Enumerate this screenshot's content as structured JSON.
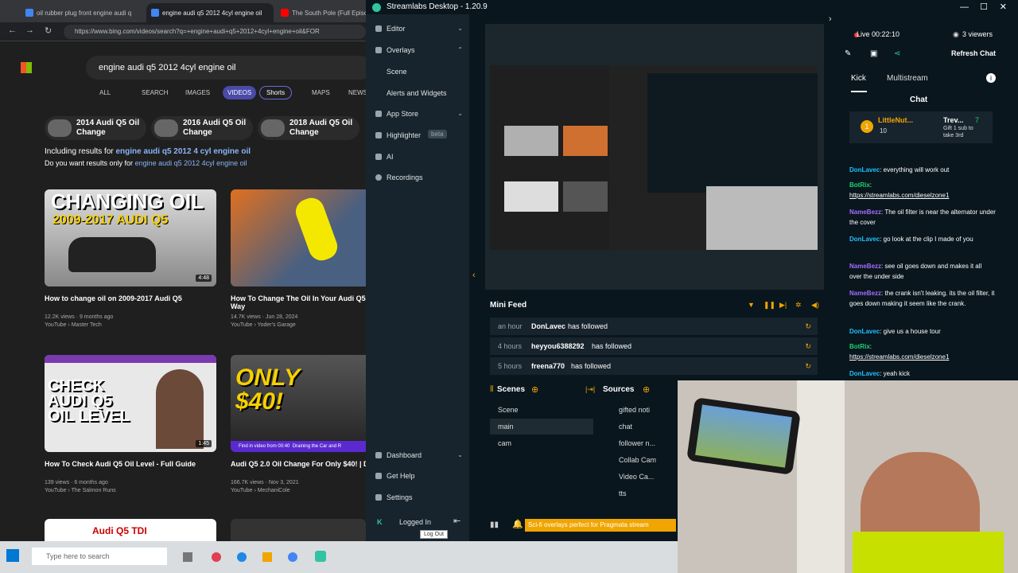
{
  "browser": {
    "tabs": [
      {
        "label": "oil rubber plug front engine audi q"
      },
      {
        "label": "engine audi q5 2012 4cyl engine oil"
      },
      {
        "label": "The South Pole (Full Episode)"
      }
    ],
    "url": "https://www.bing.com/videos/search?q=+engine+audi+q5+2012+4cyl+engine+oil&FOR",
    "search_value": "engine audi q5 2012 4cyl engine oil",
    "nav": [
      "ALL",
      "SEARCH",
      "IMAGES",
      "VIDEOS",
      "Shorts",
      "MAPS",
      "NEWS"
    ],
    "chips": [
      {
        "line1": "2014 Audi Q5 Oil",
        "line2": "Change"
      },
      {
        "line1": "2016 Audi Q5 Oil",
        "line2": "Change"
      },
      {
        "line1": "2018 Audi Q5 Oil",
        "line2": "Change"
      }
    ],
    "including_prefix": "Including results for ",
    "including_query": "engine audi q5 2012 4 cyl engine oil",
    "dym_prefix": "Do you want results only for ",
    "dym_query": "engine audi q5 2012 4cyl engine oil",
    "videos": [
      {
        "overlay": "CHANGING OIL",
        "overlay2": "2009-2017 AUDI Q5",
        "duration": "4:48",
        "title": "How to change oil on 2009-2017 Audi Q5",
        "meta1": "12.2K views · 9 months ago",
        "meta2": "YouTube › Master Tech"
      },
      {
        "overlay": "",
        "overlay2": "",
        "duration": "",
        "title": "How To Change The Oil In Your Audi Q5 T",
        "title2": "Way",
        "meta1": "14.7K views · Jun 28, 2024",
        "meta2": "YouTube › Yoder's Garage"
      },
      {
        "overlay": "CHECK",
        "overlay2": "AUDI Q5",
        "overlay3": "OIL LEVEL",
        "duration": "1:45",
        "title": "How To Check Audi Q5 Oil Level - Full Guide",
        "meta1": "139 views · 6 months ago",
        "meta2": "YouTube › The Salmon Runs"
      },
      {
        "overlay": "ONLY",
        "overlay2": "$40!",
        "find": "Find in video from 00:40",
        "find2": "Draining the Car and R",
        "duration": "",
        "title": "Audi Q5 2.0 Oil Change For Only $40! | D",
        "meta1": "166.7K views · Nov 3, 2021",
        "meta2": "YouTube › MechaniCole"
      },
      {
        "overlay": "Audi Q5 TDI"
      }
    ]
  },
  "streamlabs": {
    "title": "Streamlabs Desktop - 1.20.9",
    "sidebar": [
      "Editor",
      "Overlays",
      "Scene",
      "Alerts and Widgets",
      "App Store",
      "Highlighter",
      "AI",
      "Recordings"
    ],
    "beta": "beta",
    "sidebar_bottom": [
      "Dashboard",
      "Get Help",
      "Settings",
      "Logged In"
    ],
    "logout_tip": "Log Out",
    "minifeed_title": "Mini Feed",
    "feed": [
      {
        "time": "an hour",
        "name": "DonLavec",
        "action": "has followed"
      },
      {
        "time": "4 hours",
        "name": "heyyou6388292",
        "action": "has followed"
      },
      {
        "time": "5 hours",
        "name": "freena770",
        "action": "has followed"
      }
    ],
    "scenes_title": "Scenes",
    "sources_title": "Sources",
    "scenes": [
      "Scene",
      "main",
      "cam"
    ],
    "sources": [
      "gifted noti",
      "chat",
      "follower n...",
      "Collab Cam",
      "Video Ca...",
      "tts"
    ],
    "promo": "Sci-fi overlays perfect for Pragmata stream",
    "live": "Live 00:22:10",
    "viewers": "3 viewers",
    "refresh": "Refresh Chat",
    "chat_tabs": [
      "Kick",
      "Multistream"
    ],
    "chat_title": "Chat",
    "pinned": {
      "user": "LittleNut...",
      "count": "10",
      "user2": "Trev...",
      "n": "7",
      "gift": "Gift 1 sub to",
      "gift2": "take 3rd"
    },
    "messages": [
      {
        "u": "DonLavec",
        "c": "u1",
        "t": ": everything will work out"
      },
      {
        "u": "BotRix",
        "c": "u3",
        "t": ":",
        "link": "https://streamlabs.com/dieselzone1"
      },
      {
        "u": "NameBezz",
        "c": "u2",
        "t": ": The oil filter is near the alternator under the cover"
      },
      {
        "u": "DonLavec",
        "c": "u1",
        "t": ": go look at the clip I made of you"
      },
      {
        "u": "NameBezz",
        "c": "u2",
        "t": ": see oil goes down and makes it all over the under side"
      },
      {
        "u": "NameBezz",
        "c": "u2",
        "t": ": the crank isn't leaking. its the oil filter, it goes down making it seem like the crank."
      },
      {
        "u": "DonLavec",
        "c": "u1",
        "t": ": give us a house tour"
      },
      {
        "u": "BotRix",
        "c": "u3",
        "t": ":",
        "link": "https://streamlabs.com/dieselzone1"
      },
      {
        "u": "DonLavec",
        "c": "u1",
        "t": ": yeah kick"
      }
    ]
  },
  "taskbar": {
    "search_placeholder": "Type here to search"
  }
}
